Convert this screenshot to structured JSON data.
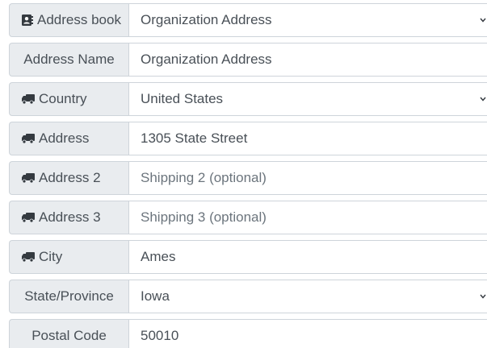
{
  "form": {
    "address_book": {
      "label": "Address book",
      "icon": "address-book-icon",
      "value": "Organization Address"
    },
    "address_name": {
      "label": "Address Name",
      "value": "Organization Address"
    },
    "country": {
      "label": "Country",
      "icon": "truck-icon",
      "value": "United States"
    },
    "address": {
      "label": "Address",
      "icon": "truck-icon",
      "value": "1305 State Street"
    },
    "address2": {
      "label": "Address 2",
      "icon": "truck-icon",
      "placeholder": "Shipping 2 (optional)"
    },
    "address3": {
      "label": "Address 3",
      "icon": "truck-icon",
      "placeholder": "Shipping 3 (optional)"
    },
    "city": {
      "label": "City",
      "icon": "truck-icon",
      "value": "Ames"
    },
    "state": {
      "label": "State/Province",
      "value": "Iowa"
    },
    "postal_code": {
      "label": "Postal Code",
      "value": "50010"
    }
  },
  "colors": {
    "addon_bg": "#e9ecef",
    "border": "#ced4da",
    "text": "#495057",
    "placeholder": "#6c757d"
  }
}
